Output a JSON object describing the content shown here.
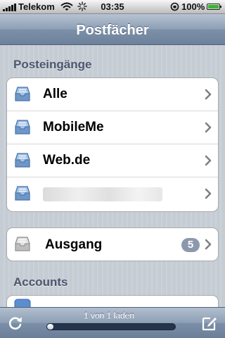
{
  "status_bar": {
    "carrier": "Telekom",
    "time": "03:35",
    "battery_percent": "100%"
  },
  "nav": {
    "title": "Postfächer"
  },
  "inboxes": {
    "header": "Posteingänge",
    "items": [
      {
        "label": "Alle"
      },
      {
        "label": "MobileMe"
      },
      {
        "label": "Web.de"
      }
    ]
  },
  "outbox": {
    "label": "Ausgang",
    "count": "5"
  },
  "accounts": {
    "header": "Accounts"
  },
  "toolbar": {
    "status_text": "1 von 1 laden",
    "progress": 0.02
  },
  "colors": {
    "nav_blue": "#6d819c",
    "badge": "#8c99ad",
    "battery_green": "#3ab52f"
  }
}
